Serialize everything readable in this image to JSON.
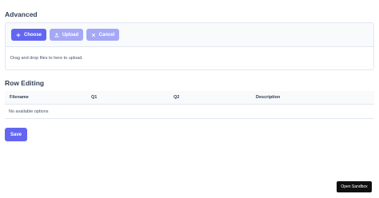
{
  "advanced": {
    "title": "Advanced",
    "buttons": {
      "choose": "Choose",
      "upload": "Upload",
      "cancel": "Cancel"
    },
    "drop_text": "Drag and drop files to here to upload."
  },
  "row_editing": {
    "title": "Row Editing",
    "columns": [
      "Filename",
      "Q1",
      "Q2",
      "Description"
    ],
    "empty_message": "No available options"
  },
  "save_label": "Save",
  "sandbox_label": "Open Sandbox",
  "colors": {
    "primary": "#6366f1",
    "primary_disabled": "#a5a8f6",
    "border": "#e2e8f0"
  },
  "icons": {
    "choose": "plus-icon",
    "upload": "upload-icon",
    "cancel": "close-icon"
  }
}
